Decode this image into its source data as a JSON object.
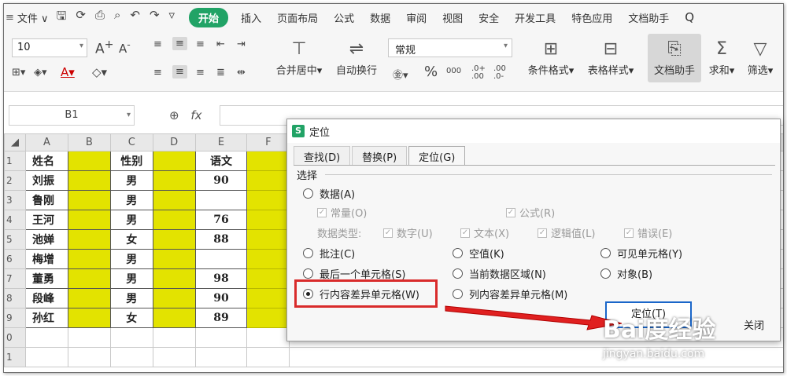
{
  "menu": {
    "file": "文件",
    "items": [
      "插入",
      "页面布局",
      "公式",
      "数据",
      "审阅",
      "视图",
      "安全",
      "开发工具",
      "特色应用",
      "文档助手"
    ],
    "active": "开始"
  },
  "ribbon": {
    "font_size": "10",
    "number_format": "常规",
    "merge": "合并居中",
    "wrap": "自动换行",
    "cond_format": "条件格式",
    "table_style": "表格样式",
    "doc_assist": "文档助手",
    "sum": "求和",
    "filter": "筛选"
  },
  "formula_bar": {
    "name_box": "B1",
    "fx": "fx"
  },
  "sheet": {
    "columns": [
      "A",
      "B",
      "C",
      "D",
      "E",
      "F"
    ],
    "rows": [
      {
        "num": "1",
        "a": "姓名",
        "c": "性别",
        "e": "语文"
      },
      {
        "num": "2",
        "a": "刘振",
        "c": "男",
        "e": "90"
      },
      {
        "num": "3",
        "a": "鲁刚",
        "c": "男",
        "e": ""
      },
      {
        "num": "4",
        "a": "王河",
        "c": "男",
        "e": "76"
      },
      {
        "num": "5",
        "a": "池婵",
        "c": "女",
        "e": "88"
      },
      {
        "num": "6",
        "a": "梅增",
        "c": "男",
        "e": ""
      },
      {
        "num": "7",
        "a": "董勇",
        "c": "男",
        "e": "98"
      },
      {
        "num": "8",
        "a": "段峰",
        "c": "男",
        "e": "90"
      },
      {
        "num": "9",
        "a": "孙红",
        "c": "女",
        "e": "89"
      },
      {
        "num": "0",
        "a": "",
        "c": "",
        "e": ""
      },
      {
        "num": "1",
        "a": "",
        "c": "",
        "e": ""
      }
    ]
  },
  "dialog": {
    "title": "定位",
    "tabs": [
      "查找(D)",
      "替换(P)",
      "定位(G)"
    ],
    "section": "选择",
    "data": "数据(A)",
    "constant": "常量(O)",
    "formula": "公式(R)",
    "data_type_label": "数据类型:",
    "number": "数字(U)",
    "text": "文本(X)",
    "logic": "逻辑值(L)",
    "error": "错误(E)",
    "comment": "批注(C)",
    "blank": "空值(K)",
    "visible": "可见单元格(Y)",
    "last_cell": "最后一个单元格(S)",
    "current_region": "当前数据区域(N)",
    "object": "对象(B)",
    "row_diff": "行内容差异单元格(W)",
    "col_diff": "列内容差异单元格(M)",
    "ok": "定位(T)",
    "close": "关闭"
  },
  "watermark": {
    "big": "Bai度经验",
    "small": "jingyan.baidu.com"
  }
}
